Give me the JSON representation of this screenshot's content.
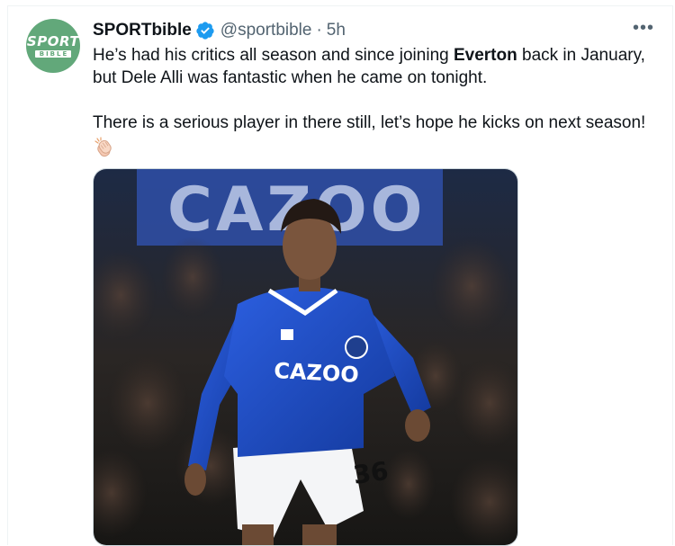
{
  "tweet": {
    "display_name": "SPORTbible",
    "handle": "@sportbible",
    "separator": "·",
    "time": "5h",
    "more": "•••",
    "avatar": {
      "logo_top": "SPORT",
      "logo_bottom": "BIBLE"
    },
    "text": {
      "line1_prefix": "He’s had his critics all season and since joining ",
      "line1_bold": "Everton",
      "line1_suffix": " back in January, but Dele Alli was fantastic when he came on tonight.",
      "line2": "There is a serious player in there still, let’s hope he kicks on next season!",
      "emoji": "clapping-hands-icon"
    },
    "media": {
      "banner_text": "CAZOO",
      "shirt_sponsor": "CAZOO",
      "shirt_number": "36"
    }
  },
  "colors": {
    "verified_blue": "#1d9bf0",
    "avatar_green": "#62a87a",
    "secondary_text": "#536471",
    "everton_blue": "#1c4fc3"
  }
}
